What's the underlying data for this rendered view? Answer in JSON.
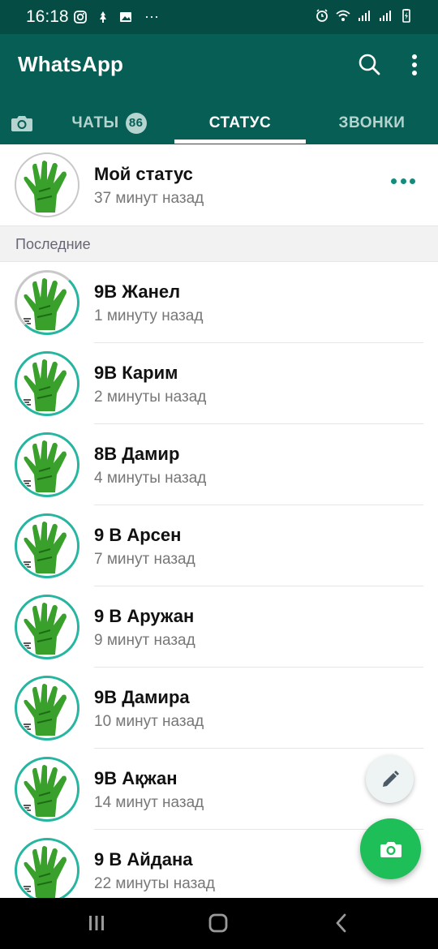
{
  "status_bar": {
    "time": "16:18",
    "more_indicator": "···",
    "left_icons": [
      "instagram-icon",
      "app-notification-icon",
      "image-icon"
    ],
    "right_icons": [
      "alarm-icon",
      "wifi-icon",
      "signal-icon",
      "signal-icon",
      "battery-icon"
    ]
  },
  "app": {
    "title": "WhatsApp"
  },
  "tabs": [
    {
      "id": "camera",
      "icon": "camera-icon"
    },
    {
      "id": "chats",
      "label": "ЧАТЫ",
      "badge": "86"
    },
    {
      "id": "status",
      "label": "СТАТУС",
      "selected": true
    },
    {
      "id": "calls",
      "label": "ЗВОНКИ"
    }
  ],
  "my_status": {
    "name": "Мой статус",
    "time": "37 минут назад"
  },
  "section": {
    "label": "Последние"
  },
  "statuses": [
    {
      "name": "9В Жанел",
      "time": "1 минуту назад",
      "ring": "partial"
    },
    {
      "name": "9В Карим",
      "time": "2 минуты назад",
      "ring": "full"
    },
    {
      "name": "8В Дамир",
      "time": "4 минуты назад",
      "ring": "full"
    },
    {
      "name": "9 В Арсен",
      "time": "7 минут назад",
      "ring": "full"
    },
    {
      "name": "9 В Аружан",
      "time": "9 минут назад",
      "ring": "full"
    },
    {
      "name": "9В Дамира",
      "time": "10 минут назад",
      "ring": "full"
    },
    {
      "name": "9В Ақжан",
      "time": "14 минут назад",
      "ring": "full"
    },
    {
      "name": "9 В Айдана",
      "time": "22 минуты назад",
      "ring": "full"
    }
  ],
  "colors": {
    "header": "#075e54",
    "statusbar": "#054d44",
    "accent": "#128c7e",
    "ring": "#25b5a0",
    "fab": "#1ebe59"
  },
  "fabs": {
    "pencil": "pencil-icon",
    "camera": "camera-icon"
  },
  "nav": [
    "recent-apps-icon",
    "home-icon",
    "back-icon"
  ]
}
